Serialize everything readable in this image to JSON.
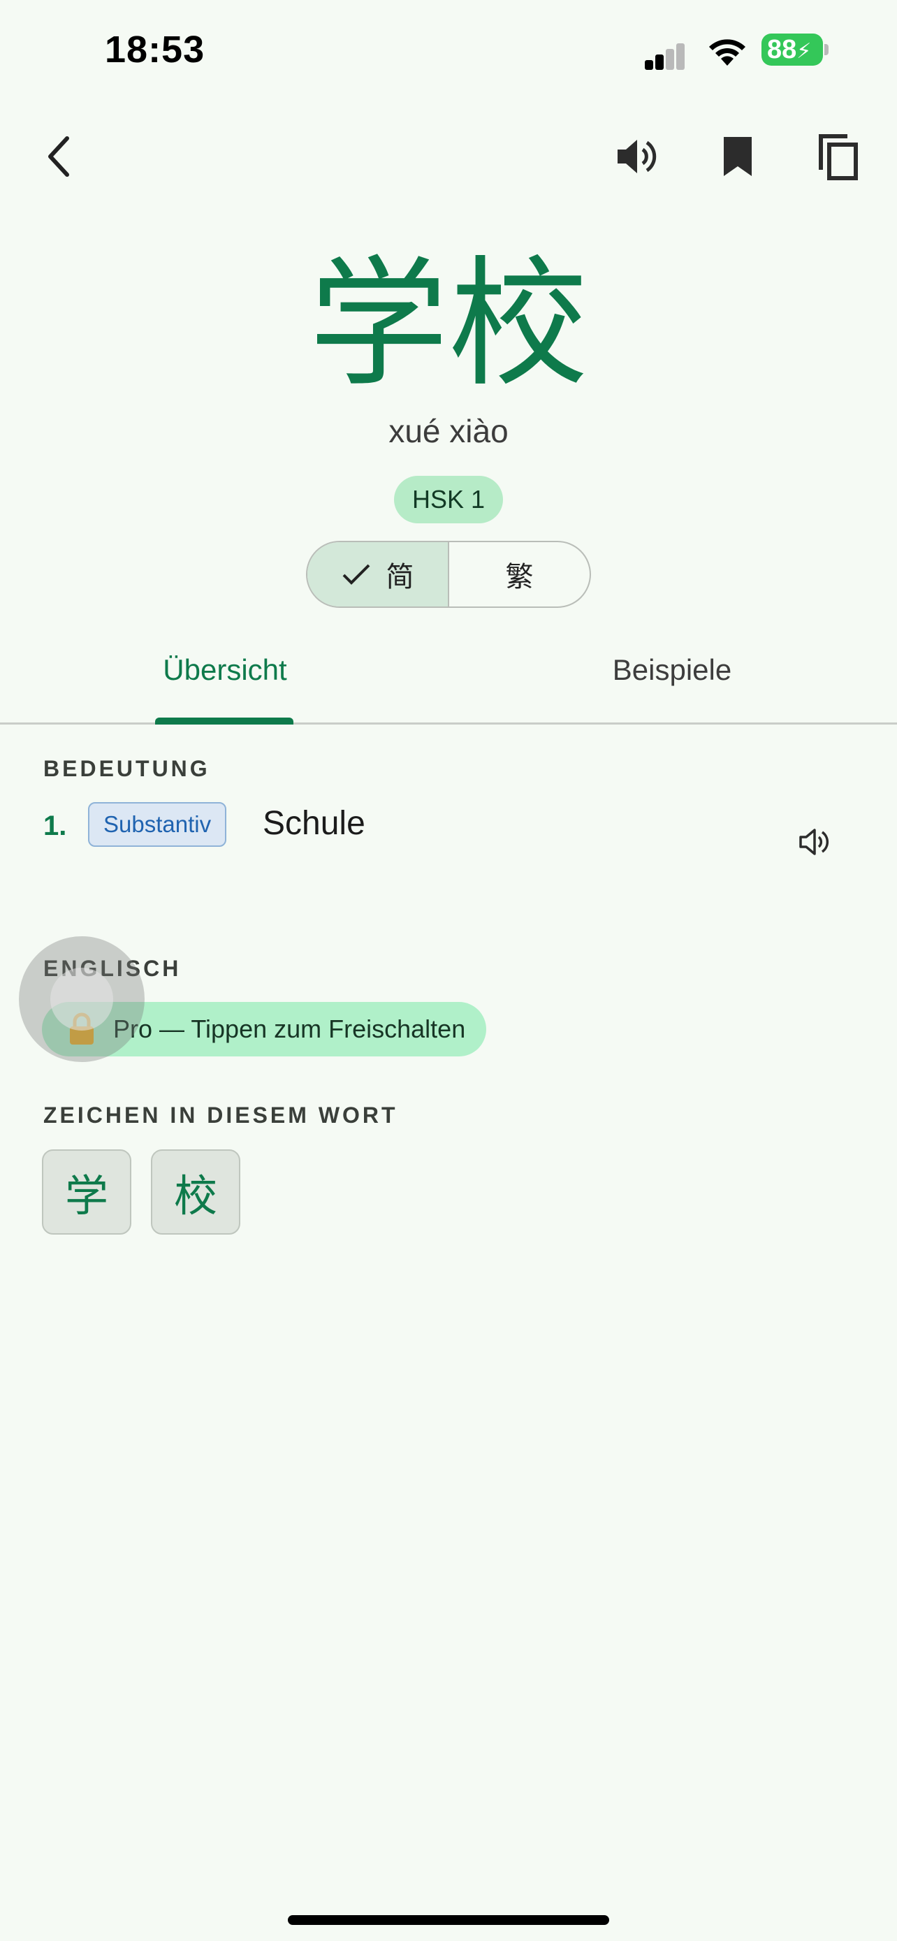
{
  "status": {
    "time": "18:53",
    "battery": "88"
  },
  "appbar": {
    "back_icon": "chevron-left-icon",
    "speaker_icon": "speaker-icon",
    "bookmark_icon": "bookmark-icon",
    "copy_icon": "copy-icon"
  },
  "word": {
    "hanzi": "学校",
    "pinyin": "xué xiào",
    "hsk": "HSK 1",
    "script_toggle": {
      "simplified": "简",
      "traditional": "繁",
      "selected": "simplified"
    }
  },
  "tabs": [
    {
      "label": "Übersicht",
      "active": true
    },
    {
      "label": "Beispiele",
      "active": false
    }
  ],
  "meaning": {
    "section_label": "BEDEUTUNG",
    "items": [
      {
        "number": "1.",
        "pos": "Substantiv",
        "text": "Schule"
      }
    ]
  },
  "english": {
    "section_label": "ENGLISCH",
    "pro_label": "Pro — Tippen zum Freischalten"
  },
  "characters": {
    "section_label": "ZEICHEN IN DIESEM WORT",
    "items": [
      "学",
      "校"
    ]
  },
  "colors": {
    "accent": "#0E7A4B",
    "background": "#F5FAF4",
    "pro_chip": "#B0F0C9",
    "pos_chip": "#DCE7F4"
  }
}
